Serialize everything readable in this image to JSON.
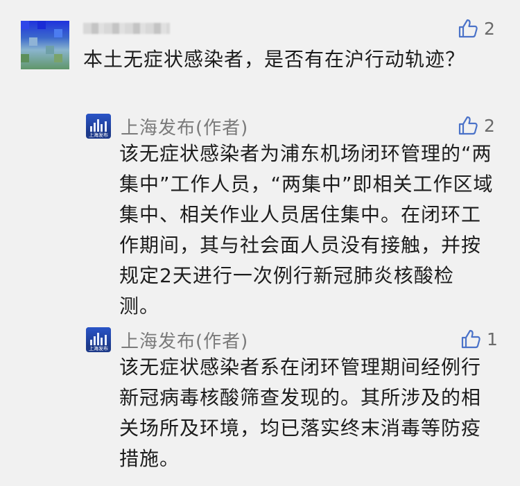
{
  "comment": {
    "text": "本土无症状感染者，是否有在沪行动轨迹？",
    "likes": "2"
  },
  "replies": [
    {
      "author": "上海发布(作者)",
      "avatar_text": "上海发布",
      "likes": "2",
      "text": "该无症状感染者为浦东机场闭环管理的“两集中”工作人员，“两集中”即相关工作区域集中、相关作业人员居住集中。在闭环工作期间，其与社会面人员没有接触，并按规定2天进行一次例行新冠肺炎核酸检测。"
    },
    {
      "author": "上海发布(作者)",
      "avatar_text": "上海发布",
      "likes": "1",
      "text": "该无症状感染者系在闭环管理期间经例行新冠病毒核酸筛查发现的。其所涉及的相关场所及环境，均已落实终末消毒等防疫措施。"
    }
  ],
  "icons": {
    "like": "thumbs-up-icon"
  },
  "colors": {
    "background": "#f1f1f1",
    "text": "#1c1c1c",
    "secondary": "#7a7a7a",
    "avatar_blue": "#1d3a8a"
  }
}
